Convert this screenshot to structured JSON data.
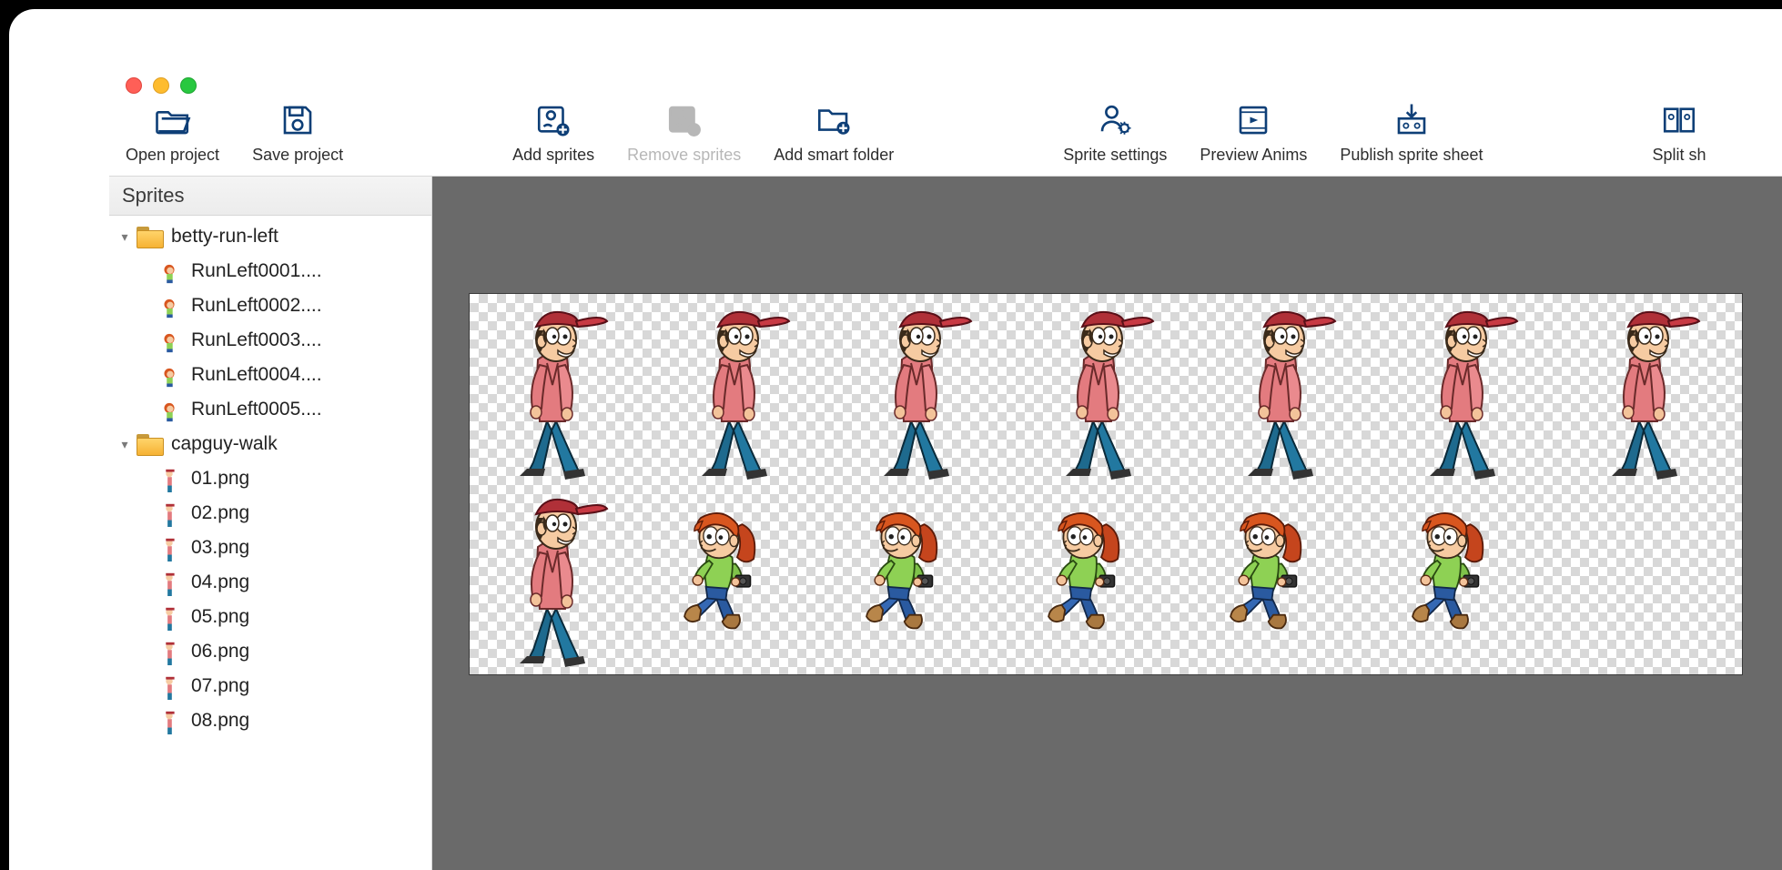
{
  "traffic": {
    "red": "#ff5f57",
    "yellow": "#febc2e",
    "green": "#28c840"
  },
  "toolbar": {
    "open_project": "Open project",
    "save_project": "Save project",
    "add_sprites": "Add sprites",
    "remove_sprites": "Remove sprites",
    "add_smart_folder": "Add smart folder",
    "sprite_settings": "Sprite settings",
    "preview_anims": "Preview Anims",
    "publish_sprite_sheet": "Publish sprite sheet",
    "split_sheet": "Split sh"
  },
  "sidebar": {
    "header": "Sprites",
    "folders": [
      {
        "name": "betty-run-left",
        "expanded": true,
        "files": [
          "RunLeft0001....",
          "RunLeft0002....",
          "RunLeft0003....",
          "RunLeft0004....",
          "RunLeft0005...."
        ]
      },
      {
        "name": "capguy-walk",
        "expanded": true,
        "files": [
          "01.png",
          "02.png",
          "03.png",
          "04.png",
          "05.png",
          "06.png",
          "07.png",
          "08.png"
        ]
      }
    ]
  },
  "colors": {
    "brand_stroke": "#0e3f77",
    "disabled": "#b7b7b7",
    "canvas_bg": "#6a6a6a"
  }
}
